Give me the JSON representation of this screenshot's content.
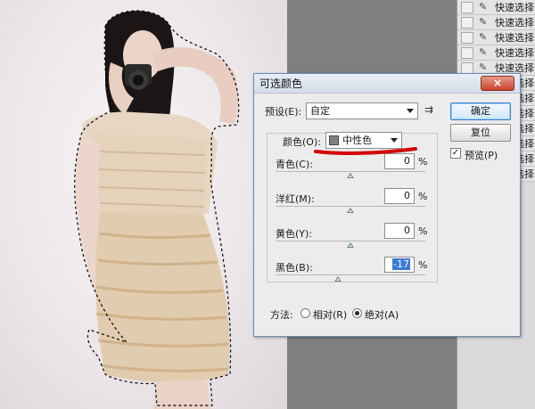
{
  "history": {
    "items": [
      {
        "label": "快速选择"
      },
      {
        "label": "快速选择"
      },
      {
        "label": "快速选择"
      },
      {
        "label": "快速选择"
      },
      {
        "label": "快速选择"
      },
      {
        "label": "快速选择"
      },
      {
        "label": "快速选择"
      },
      {
        "label": "快速选择"
      },
      {
        "label": "快速选择"
      },
      {
        "label": "快速选择"
      },
      {
        "label": "快速选择"
      },
      {
        "label": "快速选择"
      }
    ],
    "icon": "quick-selection-brush-icon"
  },
  "dialog": {
    "title": "可选颜色",
    "close_label": "×",
    "preset_label": "预设(E):",
    "preset_value": "自定",
    "ok_label": "确定",
    "reset_label": "复位",
    "preview_label": "预览(P)",
    "preview_checked": true,
    "colors_label": "颜色(O):",
    "colors_value": "中性色",
    "colors_swatch": "#808080",
    "sliders": [
      {
        "label": "青色(C):",
        "value": "0",
        "unit": "%",
        "percent": 0
      },
      {
        "label": "洋红(M):",
        "value": "0",
        "unit": "%",
        "percent": 0
      },
      {
        "label": "黄色(Y):",
        "value": "0",
        "unit": "%",
        "percent": 0
      },
      {
        "label": "黑色(B):",
        "value": "-17",
        "unit": "%",
        "percent": -17
      }
    ],
    "method_label": "方法:",
    "method_options": [
      {
        "label": "相对(R)",
        "selected": false
      },
      {
        "label": "绝对(A)",
        "selected": true
      }
    ]
  },
  "annotation_color": "#d40000"
}
